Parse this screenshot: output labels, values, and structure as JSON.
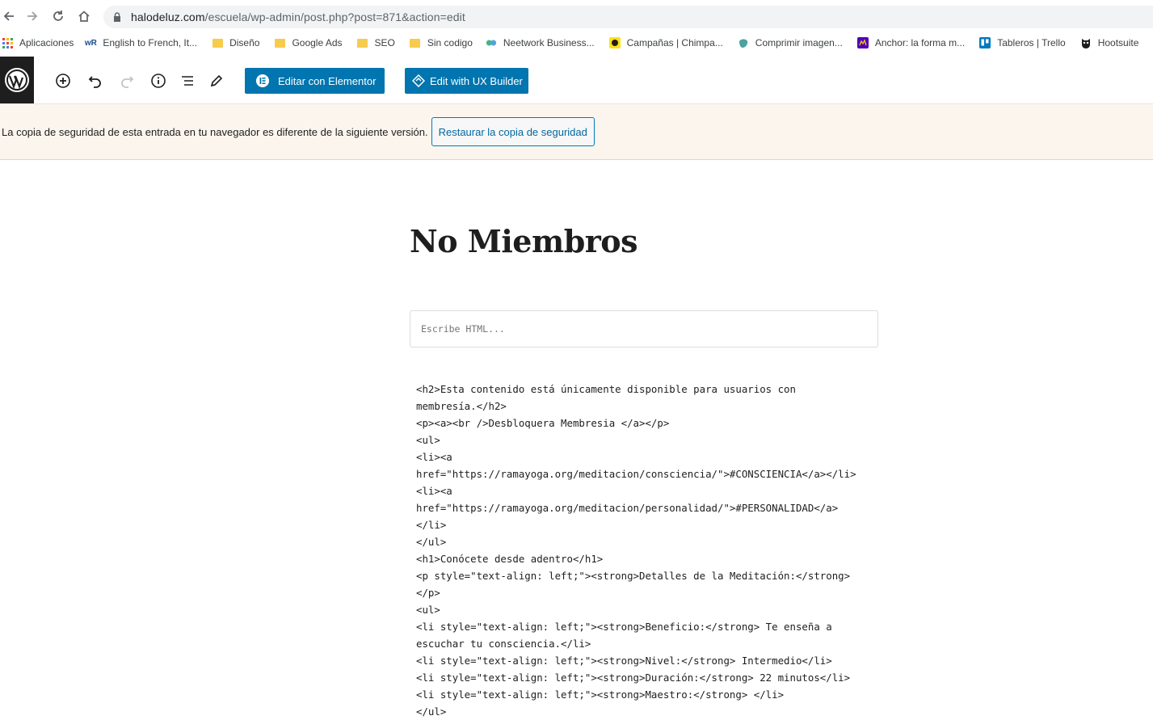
{
  "browser": {
    "url_host": "halodeluz.com",
    "url_path": "/escuela/wp-admin/post.php?post=871&action=edit",
    "bookmarks": [
      {
        "label": "Aplicaciones",
        "icon": "apps-grid-icon"
      },
      {
        "label": "English to French, It...",
        "icon": "wordreference-icon"
      },
      {
        "label": "Diseño",
        "icon": "folder-icon"
      },
      {
        "label": "Google Ads",
        "icon": "folder-icon"
      },
      {
        "label": "SEO",
        "icon": "folder-icon"
      },
      {
        "label": "Sin codigo",
        "icon": "folder-icon"
      },
      {
        "label": "Neetwork Business...",
        "icon": "neetwork-icon"
      },
      {
        "label": "Campañas | Chimpa...",
        "icon": "mailchimp-icon"
      },
      {
        "label": "Comprimir imagen...",
        "icon": "compress-icon"
      },
      {
        "label": "Anchor: la forma m...",
        "icon": "anchor-icon"
      },
      {
        "label": "Tableros | Trello",
        "icon": "trello-icon"
      },
      {
        "label": "Hootsuite",
        "icon": "hootsuite-icon"
      }
    ]
  },
  "toolbar": {
    "elementor_label": "Editar con Elementor",
    "uxbuilder_label": "Edit with UX Builder"
  },
  "notice": {
    "text": "La copia de seguridad de esta entrada en tu navegador es diferente de la siguiente versión.",
    "button_label": "Restaurar la copia de seguridad"
  },
  "editor": {
    "title": "No Miembros",
    "html_placeholder": "Escribe HTML...",
    "code_lines": [
      "<h2>Esta contenido está únicamente disponible para usuarios con",
      "membresía.</h2>",
      "<p><a><br />Desbloquera Membresia </a></p>",
      "<ul>",
      "<li><a",
      "href=\"https://ramayoga.org/meditacion/consciencia/\">#CONSCIENCIA</a></li>",
      "<li><a",
      "href=\"https://ramayoga.org/meditacion/personalidad/\">#PERSONALIDAD</a>",
      "</li>",
      "</ul>",
      "<h1>Conócete desde adentro</h1>",
      "<p style=\"text-align: left;\"><strong>Detalles de la Meditación:</strong>",
      "</p>",
      "<ul>",
      "<li style=\"text-align: left;\"><strong>Beneficio:</strong> Te enseña a",
      "escuchar tu consciencia.</li>",
      "<li style=\"text-align: left;\"><strong>Nivel:</strong> Intermedio</li>",
      "<li style=\"text-align: left;\"><strong>Duración:</strong> 22 minutos</li>",
      "<li style=\"text-align: left;\"><strong>Maestro:</strong> </li>",
      "</ul>"
    ]
  }
}
